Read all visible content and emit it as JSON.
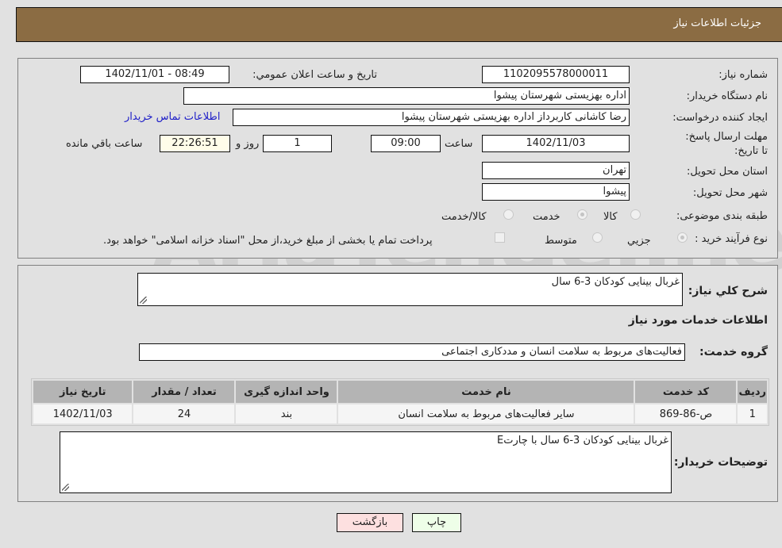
{
  "header": {
    "title": "جزئیات اطلاعات نیاز"
  },
  "form": {
    "need_number_label": "شماره نیاز:",
    "need_number": "1102095578000011",
    "announce_label": "تاريخ و ساعت اعلان عمومي:",
    "announce_value": "1402/11/01 - 08:49",
    "buyer_org_label": "نام دستگاه خریدار:",
    "buyer_org": "اداره بهزیستی شهرستان پیشوا",
    "creator_label": "ایجاد کننده درخواست:",
    "creator": "رضا کاشانی کاربرداز اداره بهزیستی شهرستان پیشوا",
    "contact_link": "اطلاعات تماس خریدار",
    "deadline_label": "مهلت ارسال پاسخ: تا تاریخ:",
    "deadline_date": "1402/11/03",
    "time_label": "ساعت",
    "deadline_time": "09:00",
    "days_value": "1",
    "days_label": "روز و",
    "remaining_time": "22:26:51",
    "remaining_label": "ساعت باقي مانده",
    "province_label": "استان محل تحویل:",
    "province": "تهران",
    "city_label": "شهر محل تحویل:",
    "city": "پیشوا",
    "category_label": "طبقه بندی موضوعی:",
    "category_options": [
      "کالا",
      "خدمت",
      "کالا/خدمت"
    ],
    "category_selected": "خدمت",
    "process_label": "نوع فرآیند خرید :",
    "process_options": [
      "جزيي",
      "متوسط"
    ],
    "process_selected": "جزيي",
    "treasury_note": "پرداخت تمام یا بخشی از مبلغ خرید،از محل \"اسناد خزانه اسلامی\" خواهد بود."
  },
  "details": {
    "summary_label": "شرح کلي نياز:",
    "summary": "غربال بینایی کودکان 3-6 سال",
    "services_heading": "اطلاعات خدمات مورد نياز",
    "service_group_label": "گروه خدمت:",
    "service_group": "فعالیت‌های مربوط به سلامت انسان و مددکاری اجتماعی",
    "table": {
      "headers": [
        "رديف",
        "کد خدمت",
        "نام خدمت",
        "واحد اندازه گیری",
        "تعداد / مقدار",
        "تاریخ نیاز"
      ],
      "rows": [
        [
          "1",
          "ص-86-869",
          "سایر فعالیت‌های مربوط به سلامت انسان",
          "بند",
          "24",
          "1402/11/03"
        ]
      ]
    },
    "buyer_notes_label": "توضيحات خريدار:",
    "buyer_notes": "غربال بینایی کودکان 3-6 سال با چارتE"
  },
  "buttons": {
    "print": "چاپ",
    "back": "بازگشت"
  },
  "watermark": "AriaTender.neT"
}
